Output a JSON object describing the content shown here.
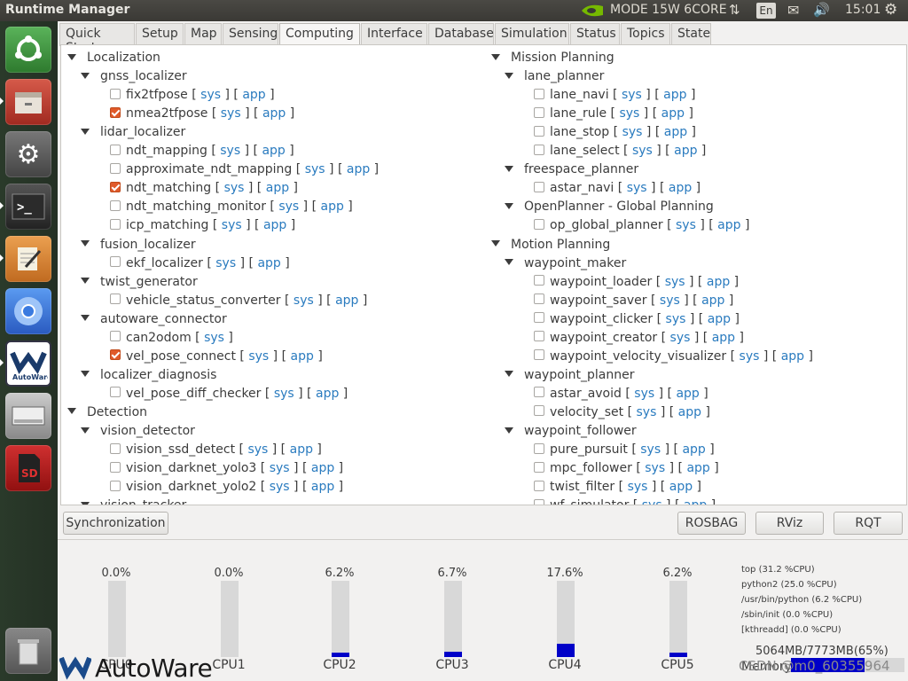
{
  "topbar": {
    "app_title": "Runtime Manager",
    "mode": "MODE 15W 6CORE",
    "lang": "En",
    "time": "15:01"
  },
  "launcher": {
    "items": [
      {
        "name": "ubuntu-logo-icon",
        "color": "#2e8b2e"
      },
      {
        "name": "file-manager-icon",
        "color": "#c0392b"
      },
      {
        "name": "settings-icon",
        "color": "#555555"
      },
      {
        "name": "terminal-icon",
        "color": "#2b2b2b"
      },
      {
        "name": "text-editor-icon",
        "color": "#d88030"
      },
      {
        "name": "chromium-icon",
        "color": "#3a7ae0"
      },
      {
        "name": "autoware-launcher-icon",
        "color": "#1a3a6a"
      },
      {
        "name": "drive-icon",
        "color": "#999999"
      },
      {
        "name": "sd-card-icon",
        "color": "#b02020"
      },
      {
        "name": "trash-icon",
        "color": "#707070"
      }
    ]
  },
  "tabs": [
    "Quick Start",
    "Setup",
    "Map",
    "Sensing",
    "Computing",
    "Interface",
    "Database",
    "Simulation",
    "Status",
    "Topics",
    "State"
  ],
  "active_tab": "Computing",
  "sys": "sys",
  "app": "app",
  "left_tree": [
    {
      "level": 0,
      "label": "Localization"
    },
    {
      "level": 1,
      "label": "gnss_localizer"
    },
    {
      "level": 2,
      "label": "fix2tfpose",
      "checked": false
    },
    {
      "level": 2,
      "label": "nmea2tfpose",
      "checked": true
    },
    {
      "level": 1,
      "label": "lidar_localizer"
    },
    {
      "level": 2,
      "label": "ndt_mapping",
      "checked": false
    },
    {
      "level": 2,
      "label": "approximate_ndt_mapping",
      "checked": false
    },
    {
      "level": 2,
      "label": "ndt_matching",
      "checked": true
    },
    {
      "level": 2,
      "label": "ndt_matching_monitor",
      "checked": false
    },
    {
      "level": 2,
      "label": "icp_matching",
      "checked": false
    },
    {
      "level": 1,
      "label": "fusion_localizer"
    },
    {
      "level": 2,
      "label": "ekf_localizer",
      "checked": false
    },
    {
      "level": 1,
      "label": "twist_generator"
    },
    {
      "level": 2,
      "label": "vehicle_status_converter",
      "checked": false
    },
    {
      "level": 1,
      "label": "autoware_connector"
    },
    {
      "level": 2,
      "label": "can2odom",
      "checked": false,
      "no_app": true
    },
    {
      "level": 2,
      "label": "vel_pose_connect",
      "checked": true
    },
    {
      "level": 1,
      "label": "localizer_diagnosis"
    },
    {
      "level": 2,
      "label": "vel_pose_diff_checker",
      "checked": false
    },
    {
      "level": 0,
      "label": "Detection"
    },
    {
      "level": 1,
      "label": "vision_detector"
    },
    {
      "level": 2,
      "label": "vision_ssd_detect",
      "checked": false
    },
    {
      "level": 2,
      "label": "vision_darknet_yolo3",
      "checked": false
    },
    {
      "level": 2,
      "label": "vision_darknet_yolo2",
      "checked": false
    },
    {
      "level": 1,
      "label": "vision_tracker"
    }
  ],
  "right_tree": [
    {
      "level": 0,
      "label": "Mission Planning"
    },
    {
      "level": 1,
      "label": "lane_planner"
    },
    {
      "level": 2,
      "label": "lane_navi",
      "checked": false
    },
    {
      "level": 2,
      "label": "lane_rule",
      "checked": false
    },
    {
      "level": 2,
      "label": "lane_stop",
      "checked": false
    },
    {
      "level": 2,
      "label": "lane_select",
      "checked": false
    },
    {
      "level": 1,
      "label": "freespace_planner"
    },
    {
      "level": 2,
      "label": "astar_navi",
      "checked": false
    },
    {
      "level": 1,
      "label": "OpenPlanner - Global Planning"
    },
    {
      "level": 2,
      "label": "op_global_planner",
      "checked": false
    },
    {
      "level": 0,
      "label": "Motion Planning"
    },
    {
      "level": 1,
      "label": "waypoint_maker"
    },
    {
      "level": 2,
      "label": "waypoint_loader",
      "checked": false
    },
    {
      "level": 2,
      "label": "waypoint_saver",
      "checked": false
    },
    {
      "level": 2,
      "label": "waypoint_clicker",
      "checked": false
    },
    {
      "level": 2,
      "label": "waypoint_creator",
      "checked": false
    },
    {
      "level": 2,
      "label": "waypoint_velocity_visualizer",
      "checked": false
    },
    {
      "level": 1,
      "label": "waypoint_planner"
    },
    {
      "level": 2,
      "label": "astar_avoid",
      "checked": false
    },
    {
      "level": 2,
      "label": "velocity_set",
      "checked": false
    },
    {
      "level": 1,
      "label": "waypoint_follower"
    },
    {
      "level": 2,
      "label": "pure_pursuit",
      "checked": false
    },
    {
      "level": 2,
      "label": "mpc_follower",
      "checked": false
    },
    {
      "level": 2,
      "label": "twist_filter",
      "checked": false
    },
    {
      "level": 2,
      "label": "wf_simulator",
      "checked": false
    }
  ],
  "buttons": {
    "sync": "Synchronization",
    "rosbag": "ROSBAG",
    "rviz": "RViz",
    "rqt": "RQT"
  },
  "cpus": [
    {
      "label": "CPU0",
      "value": "0.0%",
      "percent": 0.0
    },
    {
      "label": "CPU1",
      "value": "0.0%",
      "percent": 0.0
    },
    {
      "label": "CPU2",
      "value": "6.2%",
      "percent": 6.2
    },
    {
      "label": "CPU3",
      "value": "6.7%",
      "percent": 6.7
    },
    {
      "label": "CPU4",
      "value": "17.6%",
      "percent": 17.6
    },
    {
      "label": "CPU5",
      "value": "6.2%",
      "percent": 6.2
    }
  ],
  "processes": [
    "top (31.2 %CPU)",
    "python2 (25.0 %CPU)",
    "/usr/bin/python (6.2 %CPU)",
    "/sbin/init (0.0 %CPU)",
    "[kthreadd] (0.0 %CPU)"
  ],
  "memory": {
    "value": "5064MB/7773MB(65%)",
    "label": "Memory",
    "percent": 65
  },
  "logo_text": "AutoWare",
  "watermark": "CSDN @m0_60355964",
  "colors": {
    "bar_fill": "#0000c8",
    "link": "#2a7bbf",
    "check_on": "#e05a2a"
  }
}
